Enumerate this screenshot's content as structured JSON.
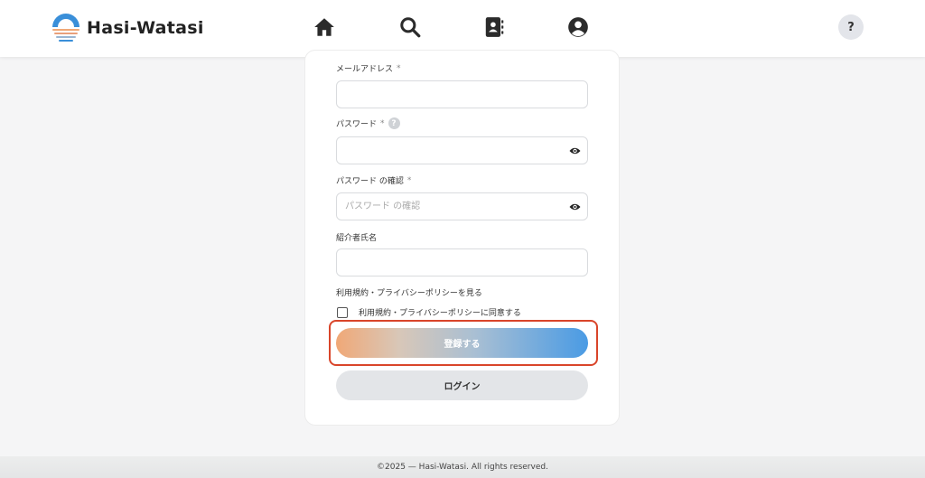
{
  "header": {
    "logo_text": "Hasi-Watasi",
    "help_label": "?",
    "nav": {
      "home_icon": "home-icon",
      "search_icon": "search-icon",
      "contacts_icon": "contact-book-icon",
      "profile_icon": "user-circle-icon"
    }
  },
  "form": {
    "email": {
      "label": "メールアドレス",
      "required": "*",
      "value": "",
      "placeholder": ""
    },
    "password": {
      "label": "パスワード",
      "required": "*",
      "value": "",
      "placeholder": ""
    },
    "password_confirm": {
      "label": "パスワード の確認",
      "required": "*",
      "value": "",
      "placeholder": "パスワード の確認"
    },
    "referrer": {
      "label": "紹介者氏名",
      "value": "",
      "placeholder": ""
    },
    "terms_link": "利用規約・プライバシーポリシーを見る",
    "agree_label": "利用規約・プライバシーポリシーに同意する",
    "agree_checked": false,
    "register_label": "登録する",
    "login_label": "ログイン"
  },
  "footer": {
    "text": "©2025 — Hasi-Watasi. All rights reserved."
  },
  "colors": {
    "highlight": "#d9452a",
    "gradient_start": "#f0a877",
    "gradient_end": "#4a9be4"
  }
}
